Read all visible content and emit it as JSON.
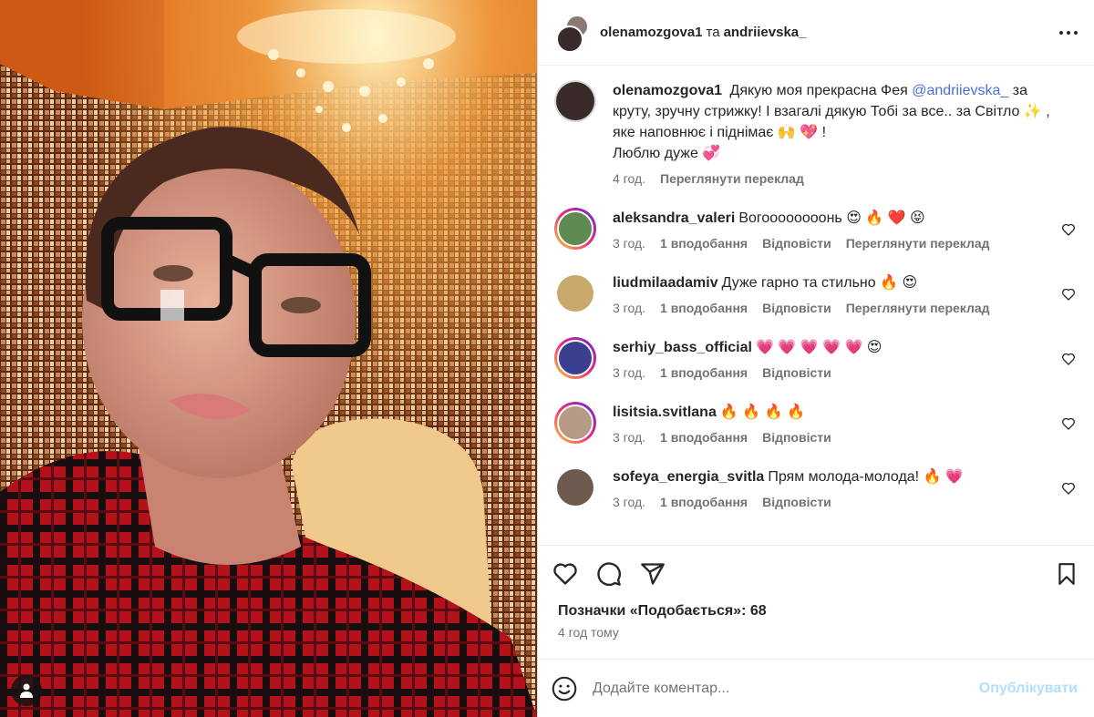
{
  "header": {
    "author": "olenamozgova1",
    "joiner": "та",
    "coauthor": "andriievska_",
    "more_icon": "more-horizontal-icon"
  },
  "caption": {
    "username": "olenamozgova1",
    "text_before": "Дякую моя прекрасна Фея",
    "mention": "@andriievska_",
    "text_after": "за круту, зручну стрижку! І взагалі дякую Тобі за все.. за Світло ✨ , яке наповнює і піднімає 🙌 💖 !",
    "line2": "Люблю дуже 💞",
    "time": "4 год.",
    "translate": "Переглянути переклад"
  },
  "comments": [
    {
      "username": "aleksandra_valeri",
      "text": "Вогоооооооонь 😍 🔥 ❤️ 😝",
      "time": "3 год.",
      "likes": "1 вподобання",
      "reply": "Відповісти",
      "translate": "Переглянути переклад",
      "avatar_color": "#5f8a52",
      "ring": true
    },
    {
      "username": "liudmilaadamiv",
      "text": "Дуже гарно та стильно 🔥 😍",
      "time": "3 год.",
      "likes": "1 вподобання",
      "reply": "Відповісти",
      "translate": "Переглянути переклад",
      "avatar_color": "#c9a96b",
      "ring": false
    },
    {
      "username": "serhiy_bass_official",
      "text": "💗 💗 💗 💗 💗 😍",
      "time": "3 год.",
      "likes": "1 вподобання",
      "reply": "Відповісти",
      "translate": "",
      "avatar_color": "#3b3f8f",
      "ring": true
    },
    {
      "username": "lisitsia.svitlana",
      "text": "🔥 🔥 🔥 🔥",
      "time": "3 год.",
      "likes": "1 вподобання",
      "reply": "Відповісти",
      "translate": "",
      "avatar_color": "#b59a86",
      "ring": true
    },
    {
      "username": "sofeya_energia_svitla",
      "text": "Прям молода-молода! 🔥 💗",
      "time": "3 год.",
      "likes": "1 вподобання",
      "reply": "Відповісти",
      "translate": "",
      "avatar_color": "#6f5a50",
      "ring": false
    }
  ],
  "actions": {
    "like_icon": "heart-icon",
    "comment_icon": "comment-icon",
    "share_icon": "paper-plane-icon",
    "save_icon": "bookmark-icon"
  },
  "likes": {
    "label": "Позначки «Подобається»:",
    "count": "68"
  },
  "post_time": "4 год тому",
  "add_comment": {
    "placeholder": "Додайте коментар...",
    "post_label": "Опублікувати",
    "emoji_icon": "smile-icon"
  },
  "colors": {
    "accent": "#0095f6",
    "post_disabled": "#b2dffc",
    "mention": "#4a6fd6",
    "muted": "#737373"
  }
}
